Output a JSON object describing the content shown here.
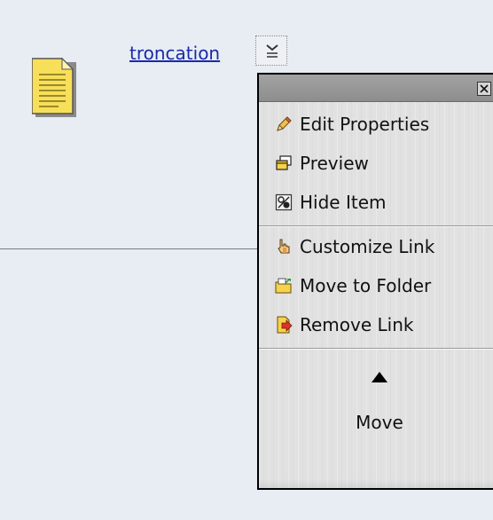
{
  "item": {
    "link_text": "troncation",
    "icon": "document-icon"
  },
  "context_menu": {
    "close_icon": "close-icon",
    "actions": [
      {
        "label": "Edit Properties",
        "icon": "pencil-icon"
      },
      {
        "label": "Preview",
        "icon": "window-icon"
      },
      {
        "label": "Hide Item",
        "icon": "hide-icon"
      }
    ],
    "link_actions": [
      {
        "label": "Customize Link",
        "icon": "hand-pointer-icon"
      },
      {
        "label": "Move to Folder",
        "icon": "folder-move-icon"
      },
      {
        "label": "Remove Link",
        "icon": "remove-link-icon"
      }
    ],
    "move": {
      "arrow_icon": "up-arrow-icon",
      "label": "Move"
    }
  },
  "colors": {
    "page_background": "#e8edf4",
    "link": "#1a2aa8",
    "menu_background": "#e1e1e1",
    "menu_titlebar": "#979797"
  }
}
